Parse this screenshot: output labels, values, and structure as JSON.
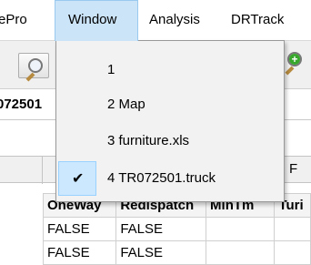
{
  "menubar": {
    "items": [
      "ePro",
      "Window",
      "Analysis",
      "DRTrack"
    ]
  },
  "addressbar": {
    "text": "072501"
  },
  "window_menu": {
    "items": [
      {
        "label": "1",
        "checked": false
      },
      {
        "label": "2 Map",
        "checked": false
      },
      {
        "label": "3 furniture.xls",
        "checked": false
      },
      {
        "label": "4 TR072501.truck",
        "checked": true
      }
    ],
    "check_glyph": "✔"
  },
  "sheet": {
    "partial_header": "F",
    "columns": [
      "OneWay",
      "Redispatch",
      "MinTm",
      "Turi"
    ],
    "rows": [
      [
        "FALSE",
        "FALSE",
        "",
        ""
      ],
      [
        "FALSE",
        "FALSE",
        "",
        ""
      ]
    ]
  }
}
